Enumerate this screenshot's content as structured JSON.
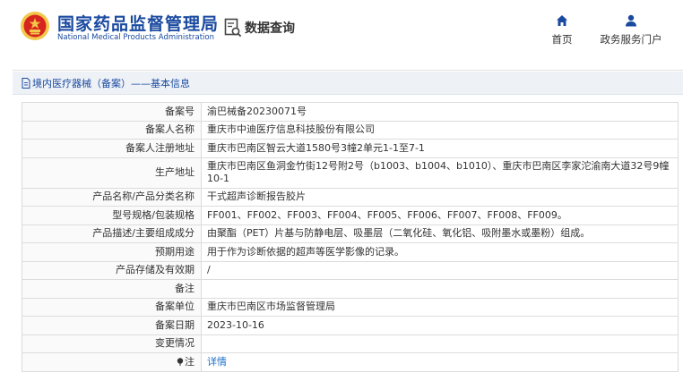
{
  "header": {
    "title_cn": "国家药品监督管理局",
    "title_en": "National Medical Products Administration",
    "data_query_label": "数据查询",
    "nav": [
      {
        "label": "首页",
        "icon": "home-icon"
      },
      {
        "label": "政务服务门户",
        "icon": "user-icon"
      }
    ]
  },
  "breadcrumb": {
    "text": "境内医疗器械（备案）——基本信息",
    "icon": "document-icon"
  },
  "details": [
    {
      "label": "备案号",
      "value": "渝巴械备20230071号"
    },
    {
      "label": "备案人名称",
      "value": "重庆市中迪医疗信息科技股份有限公司"
    },
    {
      "label": "备案人注册地址",
      "value": "重庆市巴南区智云大道1580号3幢2单元1-1至7-1"
    },
    {
      "label": "生产地址",
      "value": "重庆市巴南区鱼洞金竹街12号附2号（b1003、b1004、b1010）、重庆市巴南区李家沱渝南大道32号9幢10-1"
    },
    {
      "label": "产品名称/产品分类名称",
      "value": "干式超声诊断报告胶片"
    },
    {
      "label": "型号规格/包装规格",
      "value": "FF001、FF002、FF003、FF004、FF005、FF006、FF007、FF008、FF009。"
    },
    {
      "label": "产品描述/主要组成成分",
      "value": "由聚酯（PET）片基与防静电层、吸墨层（二氧化硅、氧化铝、吸附墨水或墨粉）组成。"
    },
    {
      "label": "预期用途",
      "value": "用于作为诊断依据的超声等医学影像的记录。"
    },
    {
      "label": "产品存储及有效期",
      "value": "/"
    },
    {
      "label": "备注",
      "value": ""
    },
    {
      "label": "备案单位",
      "value": "重庆市巴南区市场监督管理局"
    },
    {
      "label": "备案日期",
      "value": "2023-10-16"
    },
    {
      "label": "变更情况",
      "value": ""
    }
  ],
  "notes_row": {
    "label": "注",
    "label_icon": "pin-icon",
    "link": "详情"
  },
  "colors": {
    "brand": "#1a4aa0",
    "link": "#1a6ec8",
    "emblem_red": "#d7261e",
    "emblem_gold": "#f2c84b"
  }
}
